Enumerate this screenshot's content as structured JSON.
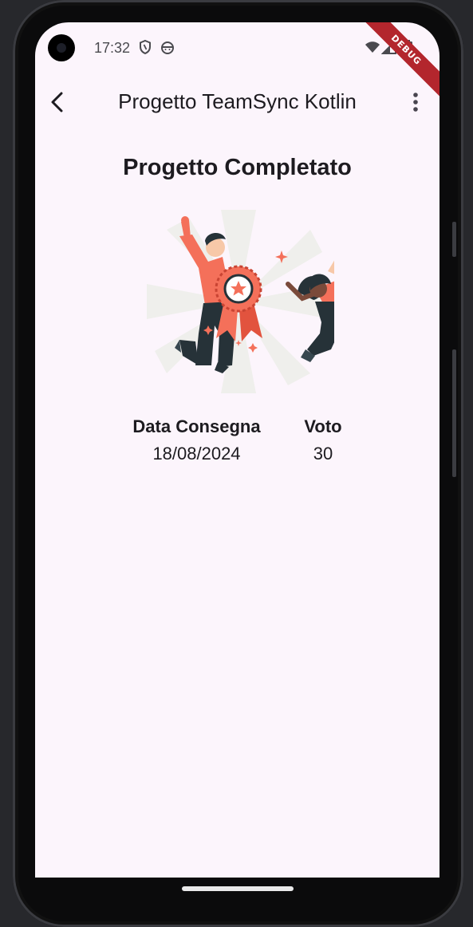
{
  "status_bar": {
    "time": "17:32",
    "icons": [
      "shield-icon",
      "android-face-icon",
      "wifi-icon",
      "signal-icon",
      "battery-icon"
    ],
    "debug_banner": "DEBUG"
  },
  "app_bar": {
    "title": "Progetto TeamSync Kotlin",
    "back_icon": "back-arrow-icon",
    "menu_icon": "more-vert-icon"
  },
  "main": {
    "heading": "Progetto Completato",
    "illustration": "celebration-award-illustration",
    "details": [
      {
        "label": "Data Consegna",
        "value": "18/08/2024"
      },
      {
        "label": "Voto",
        "value": "30"
      }
    ]
  },
  "colors": {
    "screen_background": "#fcf5fc",
    "accent": "#f4705a",
    "text": "#1d1b20",
    "debug_ribbon": "#b3262d"
  }
}
